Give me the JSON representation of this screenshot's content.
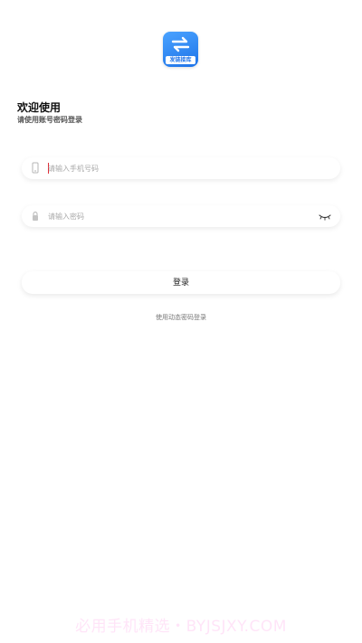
{
  "app": {
    "logo_text": "发链接库",
    "logo_icon": "swap-arrows-icon"
  },
  "welcome": {
    "title": "欢迎使用",
    "subtitle": "请使用账号密码登录"
  },
  "form": {
    "phone": {
      "value": "",
      "placeholder": "请输入手机号码",
      "icon": "phone-icon"
    },
    "password": {
      "value": "",
      "placeholder": "请输入密码",
      "icon": "lock-icon",
      "toggle_icon": "eye-closed-icon"
    },
    "login_label": "登录",
    "alt_login_label": "使用动态密码登录"
  },
  "watermark": "必用手机精选・BYJSJXY.COM",
  "colors": {
    "accent": "#1e73e8",
    "caret": "#e0303a",
    "watermark": "#ff4fd2"
  }
}
